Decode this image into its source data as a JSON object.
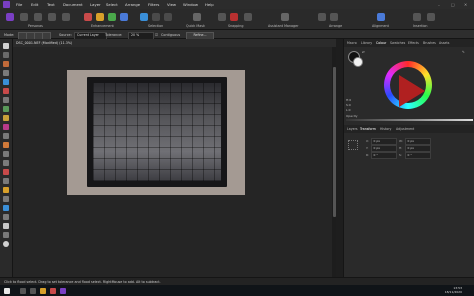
{
  "menubar": {
    "items": [
      "File",
      "Edit",
      "Text",
      "Document",
      "Layer",
      "Select",
      "Arrange",
      "Filters",
      "View",
      "Window",
      "Help"
    ]
  },
  "toolbar": {
    "personas_label": "Personas",
    "enhancement_label": "Enhancement",
    "selection_label": "Selection",
    "quick_mask_label": "Quick Mask",
    "snapping_label": "Snapping",
    "assistant_label": "Assistant Manager",
    "arrange_label": "Arrange",
    "alignment_label": "Alignment",
    "insertion_label": "Insertion",
    "colors": {
      "accent": "#7a3fc4",
      "selection": "#3a8fd8"
    }
  },
  "context": {
    "mode_label": "Mode:",
    "source_label": "Source:",
    "source_value": "Current Layer",
    "tolerance_label": "Tolerance:",
    "tolerance_value": "20 %",
    "contiguous_label": "Contiguous",
    "refine_label": "Refine..."
  },
  "document": {
    "tab_label": "DSC_0001.NEF (Modified) (11.3%)"
  },
  "panels": {
    "top_tabs": [
      "Macro",
      "Library",
      "Colour",
      "Swatches",
      "Effects",
      "Brushes",
      "Assets"
    ],
    "top_active": "Colour",
    "hsl": [
      "H:0",
      "S:0",
      "L:0"
    ],
    "opacity_label": "Opacity",
    "bottom_tabs": [
      "Layers",
      "Transform",
      "History",
      "Adjustment"
    ],
    "bottom_active": "Transform",
    "transform": [
      {
        "label": "X:",
        "value": "0 px"
      },
      {
        "label": "Y:",
        "value": "0 px"
      },
      {
        "label": "W:",
        "value": "0 px"
      },
      {
        "label": "H:",
        "value": "0 px"
      },
      {
        "label": "R:",
        "value": "0 °"
      },
      {
        "label": "S:",
        "value": "0 °"
      }
    ]
  },
  "status": {
    "text": "Click to flood select. Drag to set tolerance and flood select. RightMouse to add. Alt to subtract."
  },
  "taskbar": {
    "time": "13:53",
    "date": "18/11/2020"
  }
}
